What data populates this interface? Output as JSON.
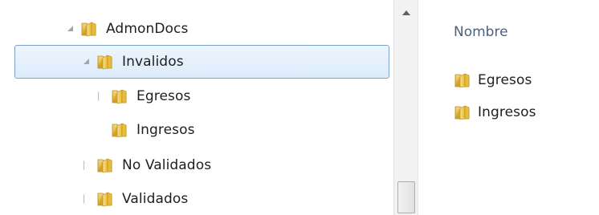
{
  "nav_tree": {
    "items": [
      {
        "label": "AdmonDocs",
        "level": 0,
        "state": "expanded",
        "selected": false
      },
      {
        "label": "Invalidos",
        "level": 1,
        "state": "expanded",
        "selected": true
      },
      {
        "label": "Egresos",
        "level": 2,
        "state": "collapsed",
        "selected": false
      },
      {
        "label": "Ingresos",
        "level": 2,
        "state": "none",
        "selected": false
      },
      {
        "label": "No Validados",
        "level": 1,
        "state": "collapsed",
        "selected": false
      },
      {
        "label": "Validados",
        "level": 1,
        "state": "collapsed",
        "selected": false
      }
    ]
  },
  "content": {
    "column_header": "Nombre",
    "items": [
      {
        "label": "Egresos",
        "icon": "folder-icon"
      },
      {
        "label": "Ingresos",
        "icon": "folder-icon"
      }
    ]
  },
  "colors": {
    "selection_fill": "#dcebfc",
    "selection_border": "#7da2ce",
    "header_text": "#4c607a",
    "folder_yellow": "#f0c94a"
  }
}
